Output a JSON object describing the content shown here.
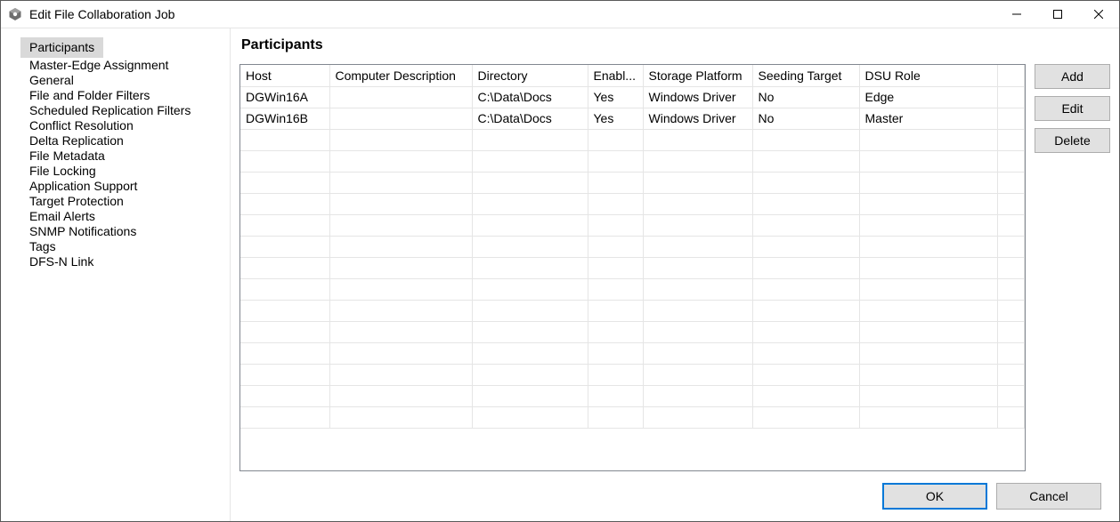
{
  "window": {
    "title": "Edit File Collaboration Job"
  },
  "sidebar": {
    "items": [
      {
        "label": "Participants",
        "selected": true
      },
      {
        "label": "Master-Edge Assignment",
        "selected": false
      },
      {
        "label": "General",
        "selected": false
      },
      {
        "label": "File and Folder Filters",
        "selected": false
      },
      {
        "label": "Scheduled Replication Filters",
        "selected": false
      },
      {
        "label": "Conflict Resolution",
        "selected": false
      },
      {
        "label": "Delta Replication",
        "selected": false
      },
      {
        "label": "File Metadata",
        "selected": false
      },
      {
        "label": "File Locking",
        "selected": false
      },
      {
        "label": "Application Support",
        "selected": false
      },
      {
        "label": "Target Protection",
        "selected": false
      },
      {
        "label": "Email Alerts",
        "selected": false
      },
      {
        "label": "SNMP Notifications",
        "selected": false
      },
      {
        "label": "Tags",
        "selected": false
      },
      {
        "label": "DFS-N Link",
        "selected": false
      }
    ]
  },
  "main": {
    "heading": "Participants",
    "table": {
      "columns": [
        "Host",
        "Computer Description",
        "Directory",
        "Enabl...",
        "Storage Platform",
        "Seeding Target",
        "DSU Role"
      ],
      "rows": [
        {
          "host": "DGWin16A",
          "desc": "",
          "dir": "C:\\Data\\Docs",
          "enabled": "Yes",
          "platform": "Windows Driver",
          "seeding": "No",
          "role": "Edge"
        },
        {
          "host": "DGWin16B",
          "desc": "",
          "dir": "C:\\Data\\Docs",
          "enabled": "Yes",
          "platform": "Windows Driver",
          "seeding": "No",
          "role": "Master"
        }
      ],
      "empty_row_count": 14
    },
    "buttons": {
      "add": "Add",
      "edit": "Edit",
      "delete": "Delete"
    }
  },
  "footer": {
    "ok": "OK",
    "cancel": "Cancel"
  }
}
